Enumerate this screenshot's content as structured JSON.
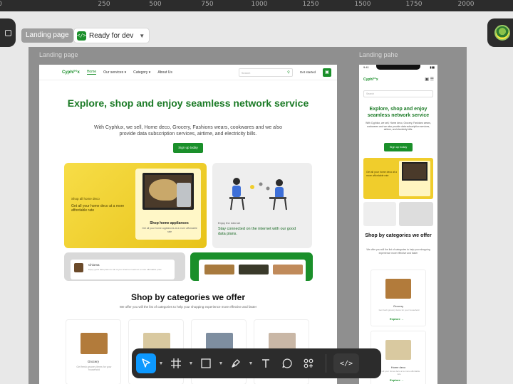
{
  "ruler": {
    "labels": [
      "0",
      "250",
      "500",
      "750",
      "1000",
      "1250",
      "1500",
      "1750",
      "2000"
    ]
  },
  "chrome": {
    "page_chip": "Landing page",
    "status_chip": "Ready for dev",
    "status_icon": "code-icon",
    "accent": "#1a8f2a",
    "toolbar_active": "#0d99ff"
  },
  "frames": {
    "desktop_label": "Landing page",
    "mobile_label": "Landing pahe"
  },
  "desktop": {
    "logo": "Cyphl°°x",
    "nav": [
      "Home",
      "Our services",
      "Category",
      "About Us"
    ],
    "search_placeholder": "Search",
    "get_started": "Get started",
    "hero_title": "Explore, shop and enjoy seamless network service",
    "hero_sub": "With Cyphlux, we sell, Home deco, Grocery, Fashions wears, cookwares and we also provide data subscription services, airtime, and electricity bills.",
    "hero_button": "Sign up today",
    "promo_yellow_tag": "Shop all home deco",
    "promo_yellow_text": "Get all your home deco at a more affordable rate",
    "promo_yellow_card_title": "Shop home appliances",
    "promo_yellow_card_sub": "Get all your home appliances at a more affordable rate",
    "promo_gray_tag": "Enjoy the internet",
    "promo_gray_text": "Stay connected on the internet with our good data plans.",
    "strip_a_name": "Chioma",
    "strip_a_text": "Enjoy good data plans for all of your internet needs at a more affordable price",
    "cat_title": "Shop by categories we offer",
    "cat_sub": "We offer you will the list of categories to help your shopping experience more effective and faster",
    "categories": [
      {
        "name": "Grocery",
        "desc": "Get fresh grocery items for your household"
      },
      {
        "name": "",
        "desc": ""
      },
      {
        "name": "",
        "desc": ""
      },
      {
        "name": "",
        "desc": ""
      }
    ]
  },
  "mobile": {
    "time": "9:41",
    "logo": "Cyphl°°x",
    "search_placeholder": "Search",
    "hero_title": "Explore, shop and enjoy seamless network service",
    "hero_sub": "With Cyphlux, we sell, Home deco, Grocery, Fashions wears, cookwares and we also provide data subscription services, airtime, and electricity bills.",
    "hero_button": "Sign up today",
    "promo_text": "Get all your home deco at a more affordable rate",
    "cat_title": "Shop by categories we offer",
    "cat_sub": "We offer you will the list of categories to help your shopping experience more effective and faster",
    "cards": [
      {
        "name": "Grocery",
        "desc": "Get fresh grocery items for your household",
        "link": "Explore"
      },
      {
        "name": "Home deco",
        "desc": "Get all your home deco at a more affordable rate",
        "link": "Explore"
      }
    ]
  },
  "toolbar": {
    "tools": [
      "move-icon",
      "frame-icon",
      "rectangle-icon",
      "pen-icon",
      "text-icon",
      "comment-icon",
      "actions-icon"
    ],
    "dev_mode": "</>"
  }
}
